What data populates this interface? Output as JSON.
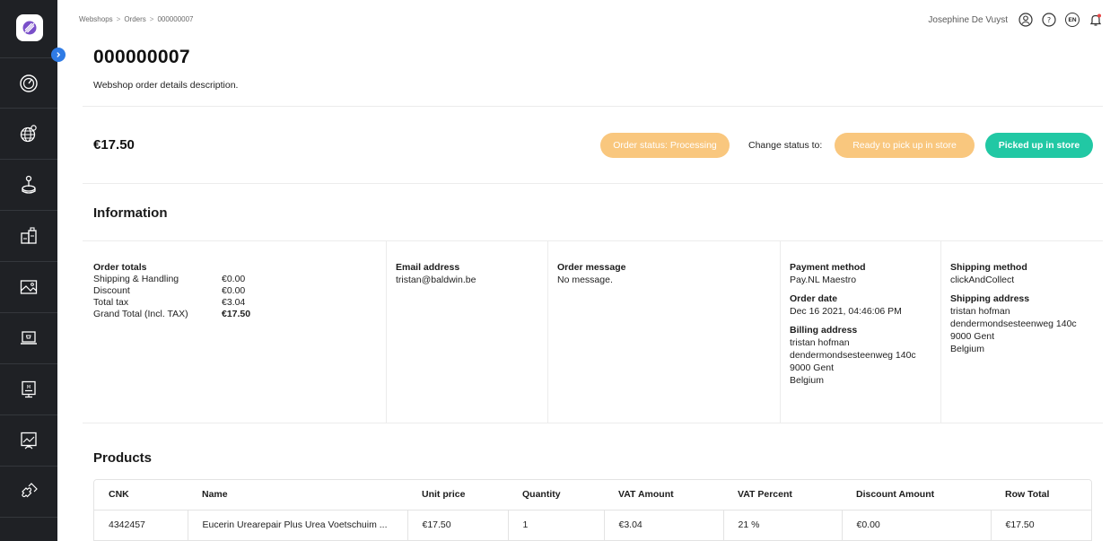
{
  "breadcrumb": [
    "Webshops",
    "Orders",
    "000000007"
  ],
  "user": {
    "name": "Josephine De Vuyst",
    "lang": "EN"
  },
  "sidebar": {
    "icons": [
      "logo-icon",
      "dashboard-icon",
      "globe-icon",
      "joystick-icon",
      "products-icon",
      "media-icon",
      "webshop-icon",
      "display-icon",
      "presentation-icon",
      "plugin-icon"
    ]
  },
  "order": {
    "title": "000000007",
    "description": "Webshop order details description.",
    "total": "€17.50",
    "status_label": "Order status: Processing",
    "change_status_label": "Change status to:",
    "status_options": [
      "Ready to pick up in store",
      "Picked up in store"
    ]
  },
  "colors": {
    "pending": "#f9c77e",
    "success": "#21c8a4",
    "accent": "#2f7be5"
  },
  "information": {
    "title": "Information",
    "order_totals": {
      "label": "Order totals",
      "rows": [
        {
          "k": "Shipping & Handling",
          "v": "€0.00"
        },
        {
          "k": "Discount",
          "v": "€0.00"
        },
        {
          "k": "Total tax",
          "v": "€3.04"
        },
        {
          "k": "Grand Total (Incl. TAX)",
          "v": "€17.50"
        }
      ]
    },
    "email": {
      "label": "Email address",
      "value": "tristan@baldwin.be"
    },
    "message": {
      "label": "Order message",
      "value": "No message."
    },
    "payment": {
      "label": "Payment method",
      "value": "Pay.NL Maestro"
    },
    "order_date": {
      "label": "Order date",
      "value": "Dec 16 2021, 04:46:06 PM"
    },
    "billing": {
      "label": "Billing address",
      "lines": [
        "tristan hofman",
        "dendermondsesteenweg 140c",
        "9000 Gent",
        "Belgium"
      ]
    },
    "shipping_method": {
      "label": "Shipping method",
      "value": "clickAndCollect"
    },
    "shipping_address": {
      "label": "Shipping address",
      "lines": [
        "tristan hofman",
        "dendermondsesteenweg 140c",
        "9000 Gent",
        "Belgium"
      ]
    }
  },
  "products": {
    "title": "Products",
    "columns": [
      "CNK",
      "Name",
      "Unit price",
      "Quantity",
      "VAT Amount",
      "VAT Percent",
      "Discount Amount",
      "Row Total"
    ],
    "rows": [
      [
        "4342457",
        "Eucerin Urearepair Plus Urea Voetschuim ...",
        "€17.50",
        "1",
        "€3.04",
        "21 %",
        "€0.00",
        "€17.50"
      ]
    ]
  }
}
